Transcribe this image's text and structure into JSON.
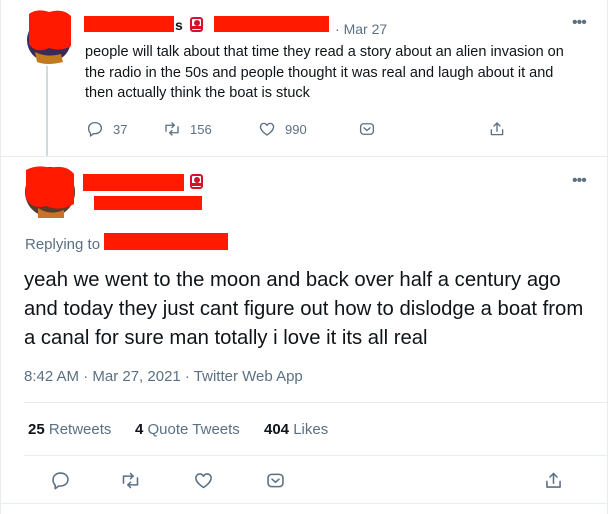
{
  "quoted_tweet": {
    "date": "Mar 27",
    "text": "people will talk about that time they read a story about an alien invasion on the radio in the 50s and people thought it was real and laugh about it and then actually think the boat is stuck",
    "name_partial": "s",
    "reply_count": "37",
    "retweet_count": "156",
    "like_count": "990"
  },
  "main_tweet": {
    "replying_label": "Replying to",
    "text": "yeah we went to the moon and back over half a century ago and today they just cant figure out how to dislodge a boat from a canal for sure man totally i love it its all real",
    "timestamp": "8:42 AM · Mar 27, 2021 · Twitter Web App",
    "stats": {
      "retweets_count": "25",
      "retweets_label": "Retweets",
      "quotes_count": "4",
      "quotes_label": "Quote Tweets",
      "likes_count": "404",
      "likes_label": "Likes"
    }
  },
  "icons": {
    "more": "more-horizontal-icon",
    "reply": "reply-icon",
    "retweet": "retweet-icon",
    "like": "heart-icon",
    "downvote": "downvote-icon",
    "share": "share-icon",
    "badge": "record-badge-icon"
  },
  "colors": {
    "redaction": "#ff1a00",
    "secondary_text": "#5b7083",
    "badge": "#d8112b",
    "divider": "#e6ecf0"
  }
}
